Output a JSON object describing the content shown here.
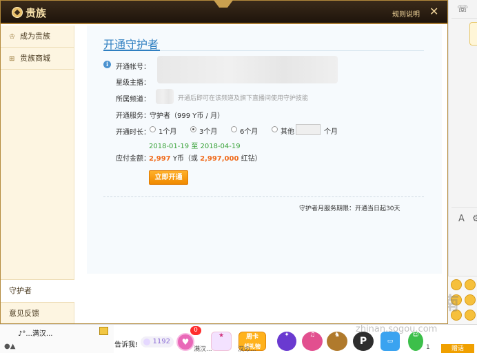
{
  "modal": {
    "title": "贵族",
    "rules_link": "规则说明",
    "close_glyph": "✕"
  },
  "sidebar": {
    "items": [
      {
        "label": "成为贵族",
        "icon": "crown-icon"
      },
      {
        "label": "贵族商城",
        "icon": "cart-icon"
      }
    ],
    "bottom": [
      {
        "label": "守护者",
        "active": true
      },
      {
        "label": "意见反馈",
        "active": false
      }
    ]
  },
  "form": {
    "title": "开通守护者",
    "account_label": "开通帐号：",
    "anchor_label": "星级主播：",
    "channel_label": "所属频道：",
    "channel_hint": "开通后即可在该频道及旗下直播间使用守护技能",
    "service_label": "开通服务：",
    "service_value": "守护者（999 Y币 / 月）",
    "duration_label": "开通时长：",
    "duration_options": [
      {
        "label": "1个月",
        "checked": false
      },
      {
        "label": "3个月",
        "checked": true
      },
      {
        "label": "6个月",
        "checked": false
      },
      {
        "label": "其他",
        "checked": false
      }
    ],
    "other_unit": "个月",
    "date_start": "2018-01-19",
    "date_to": "至",
    "date_end": "2018-04-19",
    "amount_label": "应付金额：",
    "amount_value": "2,997",
    "amount_unit": "Y币（或",
    "amount_alt": "2,997,000",
    "amount_alt_unit": "红钻）",
    "submit_label": "立即开通",
    "period_note": "守护者月服务期限：开通当日起30天"
  },
  "background": {
    "music_item": "♪°...满汉...",
    "tell_text": "告诉我!",
    "count": "1192",
    "heart_badge": "0",
    "icon_card_label": "周卡",
    "icon_card_sub": "领礼物",
    "chat_text": "满汉...",
    "chat_text2": "汉の...",
    "count_right": "1",
    "zuan_label": "赠话",
    "watermark": "搜狗指南",
    "watermark_url": "zhinan.sogou.com"
  }
}
